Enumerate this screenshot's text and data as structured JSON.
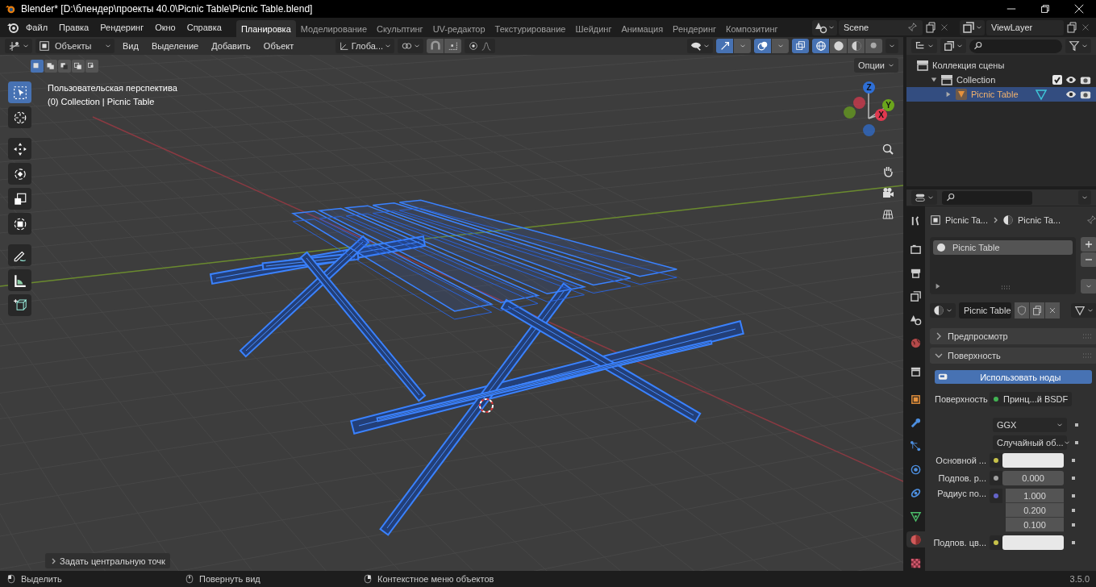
{
  "window": {
    "title": "Blender* [D:\\блендер\\проекты 40.0\\Picnic Table\\Picnic Table.blend]"
  },
  "menu": [
    "Файл",
    "Правка",
    "Рендеринг",
    "Окно",
    "Справка"
  ],
  "workspaces": [
    {
      "label": "Планировка",
      "selected": true
    },
    {
      "label": "Моделирование",
      "selected": false
    },
    {
      "label": "Скульптинг",
      "selected": false
    },
    {
      "label": "UV-редактор",
      "selected": false
    },
    {
      "label": "Текстурирование",
      "selected": false
    },
    {
      "label": "Шейдинг",
      "selected": false
    },
    {
      "label": "Анимация",
      "selected": false
    },
    {
      "label": "Рендеринг",
      "selected": false
    },
    {
      "label": "Композитинг",
      "selected": false
    }
  ],
  "scene": {
    "name": "Scene"
  },
  "view_layer": {
    "name": "ViewLayer"
  },
  "viewport": {
    "mode": "Объекты",
    "menus": [
      "Вид",
      "Выделение",
      "Добавить",
      "Объект"
    ],
    "orientation": "Глоба...",
    "options": "Опции",
    "select_modes": [
      {
        "selected": true
      },
      {
        "selected": false
      },
      {
        "selected": false
      },
      {
        "selected": false
      },
      {
        "selected": false
      }
    ],
    "shading": [
      {
        "kind": "wireframe",
        "selected": true
      },
      {
        "kind": "solid",
        "selected": false
      },
      {
        "kind": "material",
        "selected": false
      },
      {
        "kind": "rendered",
        "selected": false
      }
    ],
    "tools": [
      {
        "kind": "select",
        "selected": true
      },
      {
        "kind": "cursor",
        "selected": false
      },
      {
        "kind": "move",
        "selected": false
      },
      {
        "kind": "rotate",
        "selected": false
      },
      {
        "kind": "scale",
        "selected": false
      },
      {
        "kind": "transform",
        "selected": false
      },
      {
        "kind": "annotate",
        "selected": false
      },
      {
        "kind": "measure",
        "selected": false
      },
      {
        "kind": "add-cube",
        "selected": false
      }
    ],
    "view_name": "Пользовательская перспектива",
    "collection_info": "(0) Collection | Picnic Table",
    "gizmo": [
      {
        "label": "Z",
        "color": "#2e6fd6"
      },
      {
        "label": "Y",
        "color": "#6ba51c"
      },
      {
        "label": "X",
        "color": "#e0394f"
      }
    ],
    "last_operator": "Задать центральную точк"
  },
  "outliner": {
    "items": [
      {
        "label": "Коллекция сцены",
        "selected": false,
        "children": [
          {
            "label": "Collection",
            "expanded": true,
            "checked": true,
            "selected": false,
            "children": [
              {
                "label": "Picnic Table",
                "expanded": false,
                "selected": true
              }
            ]
          }
        ]
      }
    ]
  },
  "properties": {
    "tabs": [
      {
        "kind": "tool",
        "selected": false
      },
      {
        "kind": "render",
        "selected": false
      },
      {
        "kind": "output",
        "selected": false
      },
      {
        "kind": "view-layer",
        "selected": false
      },
      {
        "kind": "scene",
        "selected": false
      },
      {
        "kind": "world",
        "selected": false
      },
      {
        "kind": "collection",
        "selected": false
      },
      {
        "kind": "object",
        "selected": false
      },
      {
        "kind": "modifiers",
        "selected": false
      },
      {
        "kind": "particles",
        "selected": false
      },
      {
        "kind": "physics",
        "selected": false
      },
      {
        "kind": "constraints",
        "selected": false
      },
      {
        "kind": "data",
        "selected": false
      },
      {
        "kind": "material",
        "selected": true
      },
      {
        "kind": "texture",
        "selected": false
      }
    ],
    "breadcrumb": [
      "Picnic Ta...",
      "Picnic Ta..."
    ],
    "slots": [
      {
        "label": "Picnic Table",
        "selected": true
      }
    ],
    "material": "Picnic Table",
    "panels": [
      {
        "title": "Предпросмотр",
        "expanded": false
      },
      {
        "title": "Поверхность",
        "expanded": true
      }
    ],
    "use_nodes": "Использовать ноды",
    "rows": [
      {
        "kind": "link",
        "label": "Поверхность",
        "value": "Принц...й BSDF",
        "color": "#42b353"
      },
      {
        "kind": "dropdown",
        "value": "GGX"
      },
      {
        "kind": "dropdown",
        "value": "Случайный об..."
      },
      {
        "kind": "color",
        "label": "Основной ...",
        "color": "#c7c24a"
      },
      {
        "kind": "number",
        "label": "Подпов. р...",
        "color": "#a0a0a0",
        "values": [
          "0.000"
        ]
      },
      {
        "kind": "number",
        "label": "Радиус по...",
        "color": "#6464c8",
        "values": [
          "1.000",
          "0.200",
          "0.100"
        ]
      },
      {
        "kind": "color",
        "label": "Подпов. цв...",
        "color": "#c7c24a"
      }
    ]
  },
  "status_bar": {
    "items": [
      {
        "kind": "left-click",
        "label": "Выделить"
      },
      {
        "kind": "middle-click",
        "label": "Повернуть вид"
      },
      {
        "kind": "right-click",
        "label": "Контекстное меню объектов"
      }
    ],
    "version": "3.5.0"
  }
}
